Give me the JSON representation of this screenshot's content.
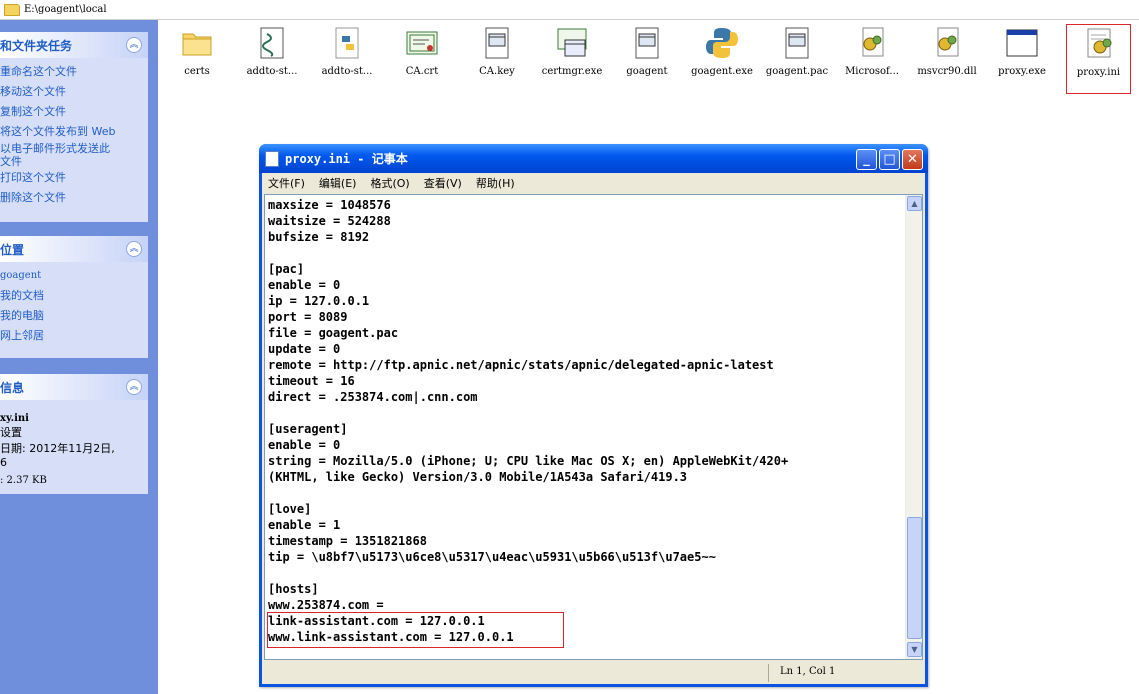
{
  "address_bar": {
    "path": "E:\\goagent\\local"
  },
  "left_pane": {
    "tasks": {
      "title": "和文件夹任务",
      "items": [
        "重命名这个文件",
        "移动这个文件",
        "复制这个文件",
        "将这个文件发布到 Web",
        "以电子邮件形式发送此",
        "文件",
        "打印这个文件",
        "删除这个文件"
      ]
    },
    "places": {
      "title": "位置",
      "items": [
        "goagent",
        "我的文档",
        "我的电脑",
        "网上邻居"
      ]
    },
    "details": {
      "title": "信息",
      "filename": "xy.ini",
      "type": "设置",
      "date_line1": "日期: 2012年11月2日,",
      "date_line2": "6",
      "size": ": 2.37 KB"
    }
  },
  "files": [
    {
      "label": "certs",
      "icon": "folder-icon"
    },
    {
      "label": "addto-st...",
      "icon": "script-icon"
    },
    {
      "label": "addto-st...",
      "icon": "python-file-icon"
    },
    {
      "label": "CA.crt",
      "icon": "certificate-icon"
    },
    {
      "label": "CA.key",
      "icon": "key-file-icon"
    },
    {
      "label": "certmgr.exe",
      "icon": "certmgr-icon"
    },
    {
      "label": "goagent",
      "icon": "file-icon"
    },
    {
      "label": "goagent.exe",
      "icon": "python-icon"
    },
    {
      "label": "goagent.pac",
      "icon": "pac-file-icon"
    },
    {
      "label": "Microsof...",
      "icon": "gear-file-icon"
    },
    {
      "label": "msvcr90.dll",
      "icon": "dll-icon"
    },
    {
      "label": "proxy.exe",
      "icon": "window-icon"
    },
    {
      "label": "proxy.ini",
      "icon": "ini-file-icon",
      "selected": true
    }
  ],
  "notepad": {
    "title": "proxy.ini - 记事本",
    "menu": [
      "文件(F)",
      "编辑(E)",
      "格式(O)",
      "查看(V)",
      "帮助(H)"
    ],
    "lines": [
      "maxsize = 1048576",
      "waitsize = 524288",
      "bufsize = 8192",
      "",
      "[pac]",
      "enable = 0",
      "ip = 127.0.0.1",
      "port = 8089",
      "file = goagent.pac",
      "update = 0",
      "remote = http://ftp.apnic.net/apnic/stats/apnic/delegated-apnic-latest",
      "timeout = 16",
      "direct = .253874.com|.cnn.com",
      "",
      "[useragent]",
      "enable = 0",
      "string = Mozilla/5.0 (iPhone; U; CPU like Mac OS X; en) AppleWebKit/420+",
      "(KHTML, like Gecko) Version/3.0 Mobile/1A543a Safari/419.3",
      "",
      "[love]",
      "enable = 1",
      "timestamp = 1351821868",
      "tip = \\u8bf7\\u5173\\u6ce8\\u5317\\u4eac\\u5931\\u5b66\\u513f\\u7ae5~~",
      "",
      "[hosts]",
      "www.253874.com =",
      "link-assistant.com = 127.0.0.1",
      "www.link-assistant.com = 127.0.0.1"
    ],
    "status": "Ln 1, Col 1",
    "buttons": {
      "minimize": "_",
      "maximize": "□",
      "close": "✕"
    }
  },
  "colors": {
    "xp_blue": "#0a55df",
    "highlight_red": "#d9262b",
    "link_blue": "#215dc6"
  }
}
